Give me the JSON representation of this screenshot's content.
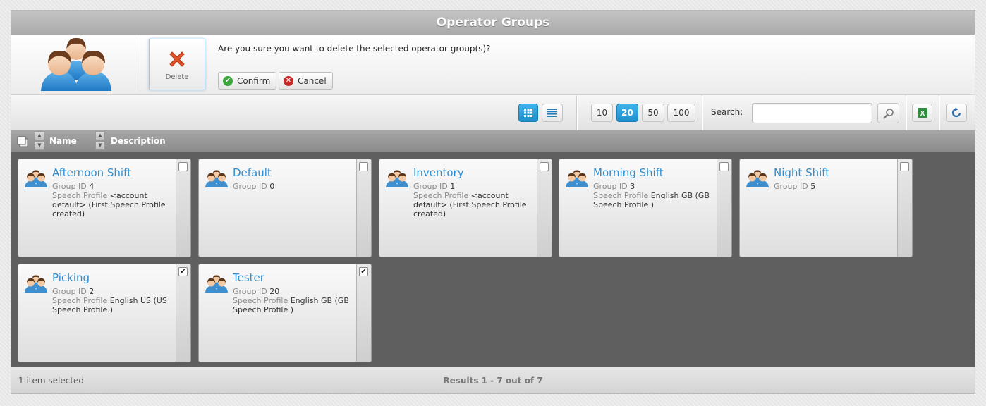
{
  "window": {
    "title": "Operator Groups"
  },
  "header": {
    "delete_label": "Delete",
    "question": "Are you sure you want to delete the selected operator group(s)?",
    "confirm_label": "Confirm",
    "cancel_label": "Cancel"
  },
  "toolbar": {
    "page_sizes": [
      "10",
      "20",
      "50",
      "100"
    ],
    "active_page_size": "20",
    "search_label": "Search:",
    "search_value": ""
  },
  "columns": {
    "name": "Name",
    "description": "Description"
  },
  "labels": {
    "group_id": "Group ID",
    "speech_profile": "Speech Profile"
  },
  "groups": [
    {
      "name": "Afternoon Shift",
      "group_id": "4",
      "speech_profile": "<account default> (First Speech Profile created)",
      "checked": false
    },
    {
      "name": "Default",
      "group_id": "0",
      "speech_profile": "",
      "checked": false
    },
    {
      "name": "Inventory",
      "group_id": "1",
      "speech_profile": "<account default> (First Speech Profile created)",
      "checked": false
    },
    {
      "name": "Morning Shift",
      "group_id": "3",
      "speech_profile": "English GB (GB Speech Profile )",
      "checked": false
    },
    {
      "name": "Night Shift",
      "group_id": "5",
      "speech_profile": "",
      "checked": false
    },
    {
      "name": "Picking",
      "group_id": "2",
      "speech_profile": "English US (US Speech Profile.)",
      "checked": true
    },
    {
      "name": "Tester",
      "group_id": "20",
      "speech_profile": "English GB (GB Speech Profile )",
      "checked": true
    }
  ],
  "footer": {
    "selection_text": "1 item selected",
    "results_text": "Results 1 - 7 out of 7"
  },
  "colors": {
    "accent": "#2e8ed1",
    "active_button": "#1d8fcb",
    "delete_red": "#e0522a",
    "confirm_green": "#3aa63a",
    "cancel_red": "#c62828"
  }
}
